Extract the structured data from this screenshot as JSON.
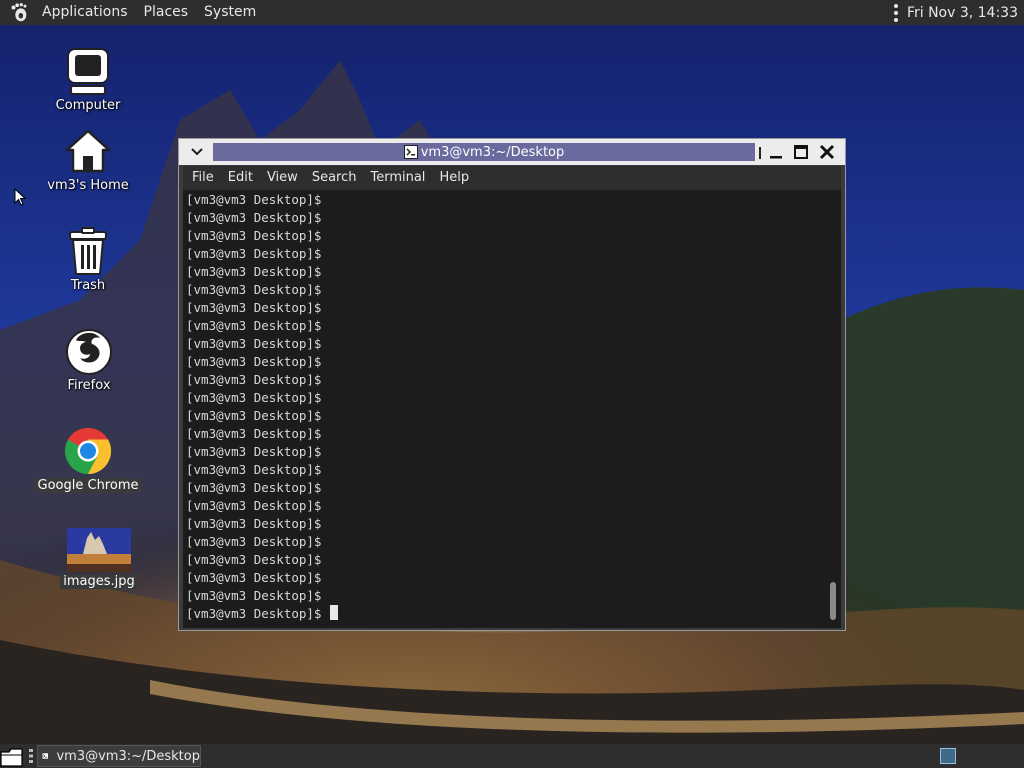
{
  "top_panel": {
    "menus": [
      "Applications",
      "Places",
      "System"
    ],
    "clock": "Fri Nov 3, 14:33"
  },
  "desktop_icons": [
    {
      "label": "Computer",
      "icon": "computer-icon"
    },
    {
      "label": "vm3's Home",
      "icon": "home-folder-icon"
    },
    {
      "label": "Trash",
      "icon": "trash-icon"
    },
    {
      "label": "Firefox",
      "icon": "firefox-icon"
    },
    {
      "label": "Google Chrome",
      "icon": "chrome-icon"
    },
    {
      "label": "images.jpg",
      "icon": "image-thumbnail-icon"
    }
  ],
  "terminal": {
    "title": "vm3@vm3:~/Desktop",
    "menu": [
      "File",
      "Edit",
      "View",
      "Search",
      "Terminal",
      "Help"
    ],
    "lines": [
      "[vm3@vm3 Desktop]$",
      "[vm3@vm3 Desktop]$",
      "[vm3@vm3 Desktop]$",
      "[vm3@vm3 Desktop]$",
      "[vm3@vm3 Desktop]$",
      "[vm3@vm3 Desktop]$",
      "[vm3@vm3 Desktop]$",
      "[vm3@vm3 Desktop]$",
      "[vm3@vm3 Desktop]$",
      "[vm3@vm3 Desktop]$",
      "[vm3@vm3 Desktop]$",
      "[vm3@vm3 Desktop]$",
      "[vm3@vm3 Desktop]$",
      "[vm3@vm3 Desktop]$",
      "[vm3@vm3 Desktop]$",
      "[vm3@vm3 Desktop]$",
      "[vm3@vm3 Desktop]$",
      "[vm3@vm3 Desktop]$",
      "[vm3@vm3 Desktop]$",
      "[vm3@vm3 Desktop]$",
      "[vm3@vm3 Desktop]$",
      "[vm3@vm3 Desktop]$",
      "[vm3@vm3 Desktop]$",
      "[vm3@vm3 Desktop]$"
    ]
  },
  "taskbar": {
    "task_label": "vm3@vm3:~/Desktop"
  },
  "colors": {
    "panel": "#2e2e2e",
    "terminal_bg": "#1c1c1c",
    "title_active": "#6a6a9e"
  }
}
